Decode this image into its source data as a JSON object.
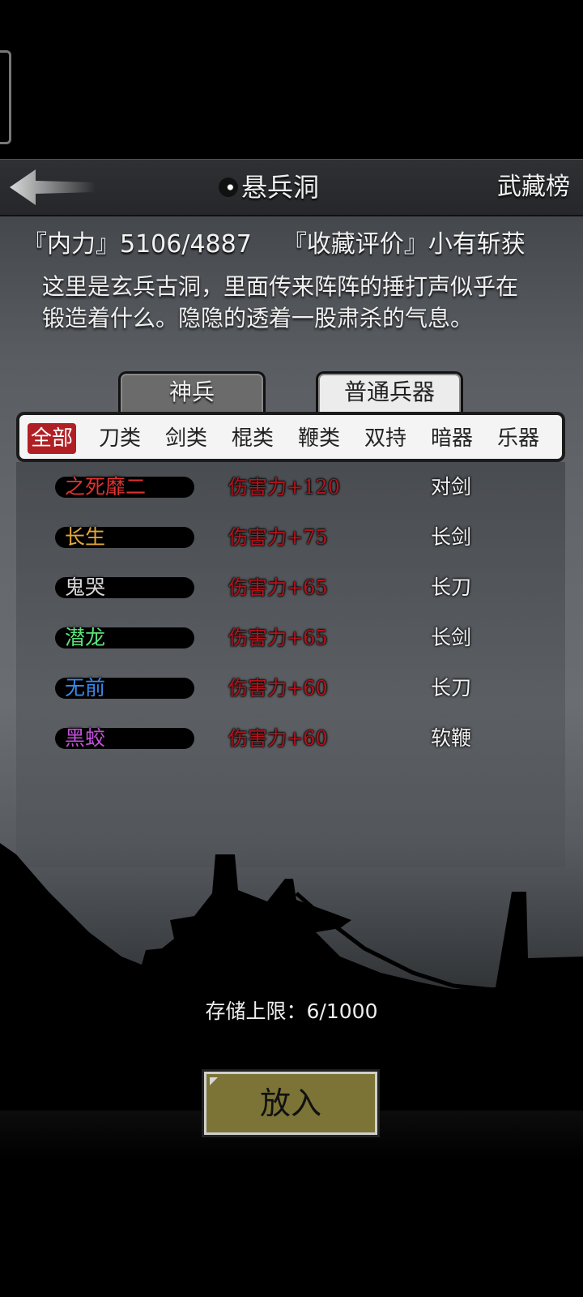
{
  "header": {
    "title": "悬兵洞",
    "rank_link": "武藏榜"
  },
  "stats": {
    "neili_label": "『内力』",
    "neili_value": "5106/4887",
    "collection_label": "『收藏评价』",
    "collection_value": "小有斩获"
  },
  "description": "这里是玄兵古洞，里面传来阵阵的捶打声似乎在锻造着什么。隐隐的透着一股肃杀的气息。",
  "tabs": [
    {
      "label": "神兵",
      "active": false
    },
    {
      "label": "普通兵器",
      "active": true
    }
  ],
  "categories": [
    {
      "label": "全部",
      "active": true
    },
    {
      "label": "刀类"
    },
    {
      "label": "剑类"
    },
    {
      "label": "棍类"
    },
    {
      "label": "鞭类"
    },
    {
      "label": "双持"
    },
    {
      "label": "暗器"
    },
    {
      "label": "乐器"
    }
  ],
  "weapons": [
    {
      "name": "之死靡二",
      "color": "#e03232",
      "damage": "伤害力+120",
      "type": "对剑"
    },
    {
      "name": "长生",
      "color": "#e3a73a",
      "damage": "伤害力+75",
      "type": "长剑"
    },
    {
      "name": "鬼哭",
      "color": "#d8d8d8",
      "damage": "伤害力+65",
      "type": "长刀"
    },
    {
      "name": "潜龙",
      "color": "#5ce27a",
      "damage": "伤害力+65",
      "type": "长剑"
    },
    {
      "name": "无前",
      "color": "#3a88e8",
      "damage": "伤害力+60",
      "type": "长刀"
    },
    {
      "name": "黑蛟",
      "color": "#c24fd8",
      "damage": "伤害力+60",
      "type": "软鞭"
    }
  ],
  "storage": {
    "label": "存储上限：",
    "value": "6/1000"
  },
  "put_button_label": "放入",
  "icons": {
    "back": "arrow-left-icon",
    "title_marker": "exclamation-dot-icon"
  }
}
